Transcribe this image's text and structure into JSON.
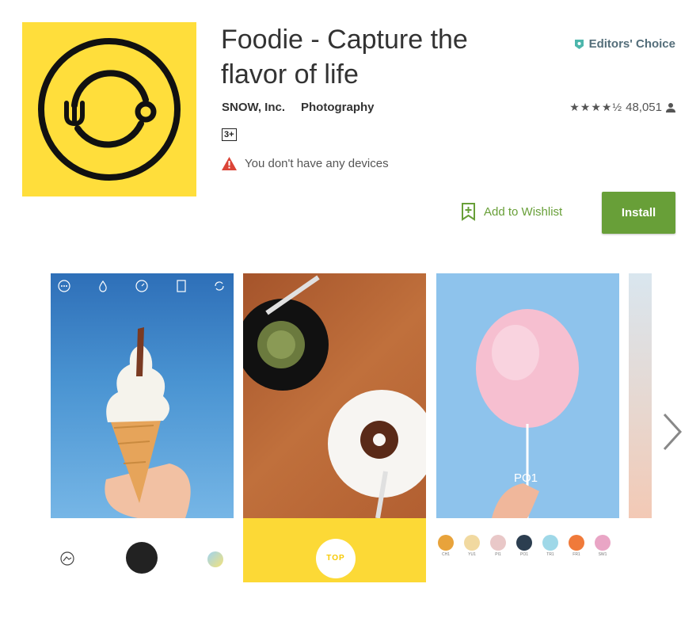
{
  "app": {
    "title": "Foodie - Capture the flavor of life",
    "developer": "SNOW, Inc.",
    "category": "Photography",
    "content_rating": "3+",
    "rating_count": "48,051",
    "rating_stars": "★★★★½",
    "editors_choice": "Editors' Choice",
    "device_warning": "You don't have any devices"
  },
  "actions": {
    "wishlist_label": "Add to Wishlist",
    "install_label": "Install"
  },
  "screenshots": {
    "shot2_button": "TOP",
    "shot3_filter_label": "PO1",
    "filters": [
      "CH1",
      "YU1",
      "PI1",
      "PO1",
      "TR1",
      "FR1",
      "SW1"
    ]
  },
  "colors": {
    "icon_yellow": "#ffde3b",
    "install_green": "#689f38",
    "editors_choice": "#546e7a",
    "warning_red": "#db4437"
  },
  "icons": {
    "editors_choice": "shield-badge-icon",
    "reviewers": "person-icon",
    "warning": "warning-triangle-icon",
    "wishlist": "bookmark-plus-icon",
    "next": "chevron-right-icon"
  }
}
